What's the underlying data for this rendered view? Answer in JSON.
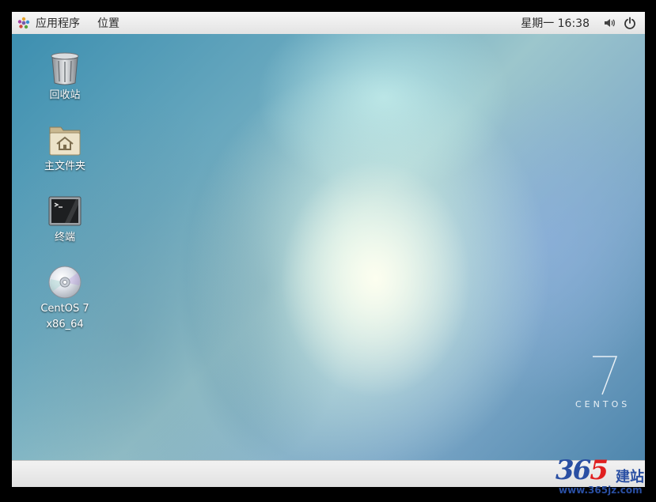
{
  "top_panel": {
    "apps_menu_label": "应用程序",
    "places_menu_label": "位置",
    "clock": "星期一 16:38",
    "volume_icon": "speaker-icon",
    "power_icon": "power-icon"
  },
  "desktop": {
    "icons": [
      {
        "label": "回收站",
        "icon": "trash-icon"
      },
      {
        "label": "主文件夹",
        "icon": "home-folder-icon"
      },
      {
        "label": "终端",
        "icon": "terminal-icon"
      },
      {
        "label_line1": "CentOS 7",
        "label_line2": "x86_64",
        "icon": "disc-icon"
      }
    ],
    "watermark_number": "7",
    "watermark_text": "CENTOS"
  },
  "site_logo": {
    "number_part": "36",
    "number_five": "5",
    "cn_text": "建站",
    "url": "www.365jz.com"
  },
  "colors": {
    "panel_bg": "#e8e8e8",
    "logo_blue": "#2a4fa3",
    "logo_red": "#e02020"
  }
}
